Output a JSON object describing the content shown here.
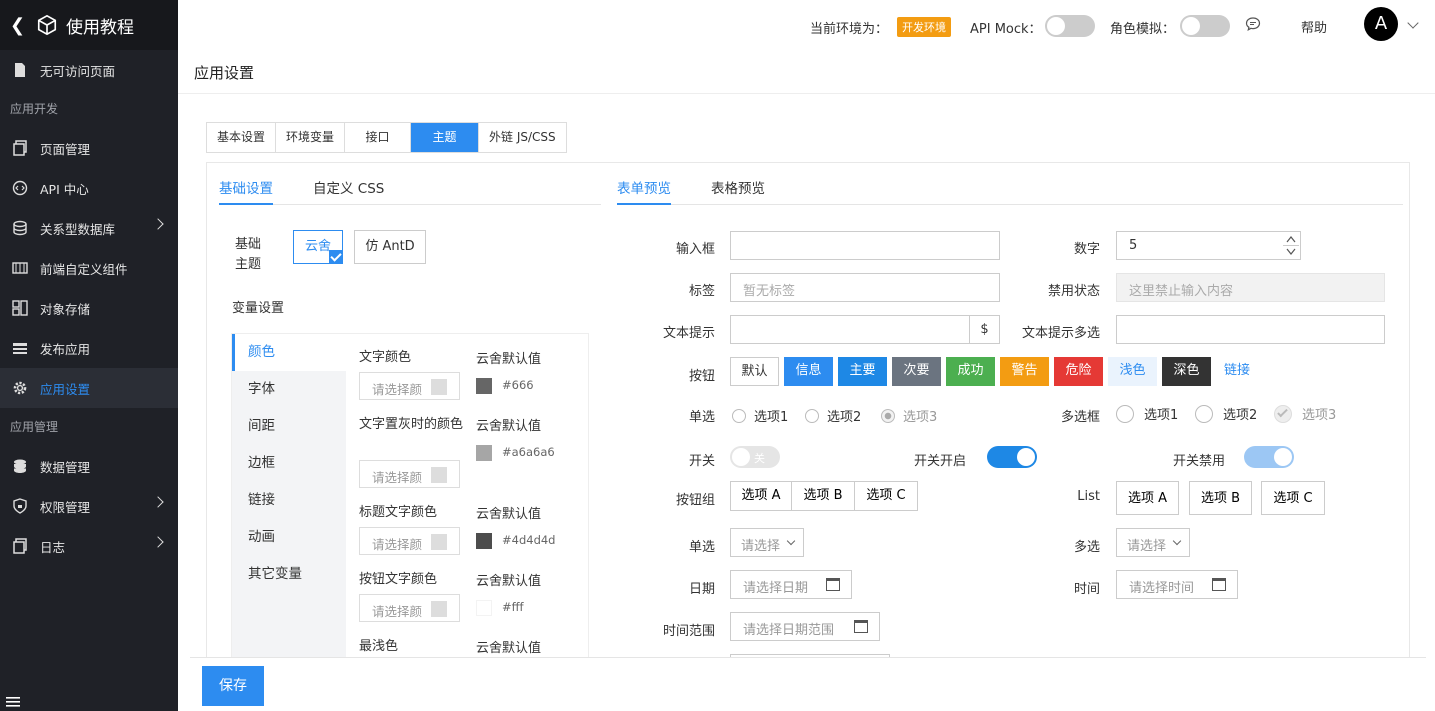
{
  "sidebar": {
    "title": "使用教程",
    "items": [
      {
        "label": "无可访问页面",
        "icon": "file-icon"
      },
      {
        "label": "页面管理",
        "icon": "pages-icon"
      },
      {
        "label": "API 中心",
        "icon": "code-icon"
      },
      {
        "label": "关系型数据库",
        "icon": "database-icon"
      },
      {
        "label": "前端自定义组件",
        "icon": "component-icon"
      },
      {
        "label": "对象存储",
        "icon": "storage-icon"
      },
      {
        "label": "发布应用",
        "icon": "publish-icon"
      },
      {
        "label": "应用设置",
        "icon": "gear-icon"
      },
      {
        "label": "数据管理",
        "icon": "database-icon"
      },
      {
        "label": "权限管理",
        "icon": "shield-icon"
      },
      {
        "label": "日志",
        "icon": "log-icon"
      }
    ],
    "groups": [
      "应用开发",
      "应用管理"
    ]
  },
  "header": {
    "env_label": "当前环境为：",
    "env_badge": "开发环境",
    "api_mock_label": "API Mock：",
    "role_label": "角色模拟：",
    "help": "帮助",
    "avatar": "A"
  },
  "page_title": "应用设置",
  "top_tabs": [
    "基本设置",
    "环境变量",
    "接口",
    "主题",
    "外链 JS/CSS"
  ],
  "left_tabs": [
    "基础设置",
    "自定义 CSS"
  ],
  "base_theme_label": "基础主题",
  "themes": [
    "云舍",
    "仿 AntD"
  ],
  "vars_label": "变量设置",
  "var_nav": [
    "颜色",
    "字体",
    "间距",
    "边框",
    "链接",
    "动画",
    "其它变量"
  ],
  "var_rows": [
    {
      "name": "文字颜色",
      "default_label": "云舍默认值",
      "placeholder": "请选择颜",
      "hex": "#666",
      "color": "#666666"
    },
    {
      "name": "文字置灰时的颜色",
      "default_label": "云舍默认值",
      "placeholder": "请选择颜",
      "hex": "#a6a6a6",
      "color": "#a6a6a6"
    },
    {
      "name": "标题文字颜色",
      "default_label": "云舍默认值",
      "placeholder": "请选择颜",
      "hex": "#4d4d4d",
      "color": "#4d4d4d"
    },
    {
      "name": "按钮文字颜色",
      "default_label": "云舍默认值",
      "placeholder": "请选择颜",
      "hex": "#fff",
      "color": "#ffffff"
    },
    {
      "name": "最浅色",
      "default_label": "云舍默认值"
    }
  ],
  "right_tabs": [
    "表单预览",
    "表格预览"
  ],
  "form": {
    "input_label": "输入框",
    "number_label": "数字",
    "number_value": "5",
    "tag_label": "标签",
    "tag_placeholder": "暂无标签",
    "disabled_label": "禁用状态",
    "disabled_placeholder": "这里禁止输入内容",
    "hint_label": "文本提示",
    "hint_addon": "$",
    "hint_multi_label": "文本提示多选",
    "button_label": "按钮",
    "buttons": [
      {
        "label": "默认",
        "bg": "#ffffff",
        "fg": "#333333"
      },
      {
        "label": "信息",
        "bg": "#2d8cf0",
        "fg": "#ffffff"
      },
      {
        "label": "主要",
        "bg": "#1e88e5",
        "fg": "#ffffff"
      },
      {
        "label": "次要",
        "bg": "#6b7480",
        "fg": "#ffffff"
      },
      {
        "label": "成功",
        "bg": "#4caf50",
        "fg": "#ffffff"
      },
      {
        "label": "警告",
        "bg": "#f39c12",
        "fg": "#ffffff"
      },
      {
        "label": "危险",
        "bg": "#e53935",
        "fg": "#ffffff"
      },
      {
        "label": "浅色",
        "bg": "#eaf3fd",
        "fg": "#2d8cf0"
      },
      {
        "label": "深色",
        "bg": "#333333",
        "fg": "#ffffff"
      },
      {
        "label": "链接",
        "bg": "transparent",
        "fg": "#2d8cf0"
      }
    ],
    "radio_label": "单选",
    "radios": [
      "选项1",
      "选项2",
      "选项3"
    ],
    "checkbox_label": "多选框",
    "checkboxes": [
      "选项1",
      "选项2",
      "选项3"
    ],
    "switch_label": "开关",
    "switch_off_text": "关",
    "switch_on_label": "开关开启",
    "switch_disabled_label": "开关禁用",
    "btn_group_label": "按钮组",
    "btn_group": [
      "选项 A",
      "选项 B",
      "选项 C"
    ],
    "list_label": "List",
    "list_items": [
      "选项 A",
      "选项 B",
      "选项 C"
    ],
    "select_label": "单选",
    "select_placeholder": "请选择",
    "multi_select_label": "多选",
    "multi_select_placeholder": "请选择",
    "date_label": "日期",
    "date_placeholder": "请选择日期",
    "time_label": "时间",
    "time_placeholder": "请选择时间",
    "range_label": "时间范围",
    "range_placeholder": "请选择日期范围"
  },
  "save_label": "保存",
  "accent": "#2d8cf0"
}
